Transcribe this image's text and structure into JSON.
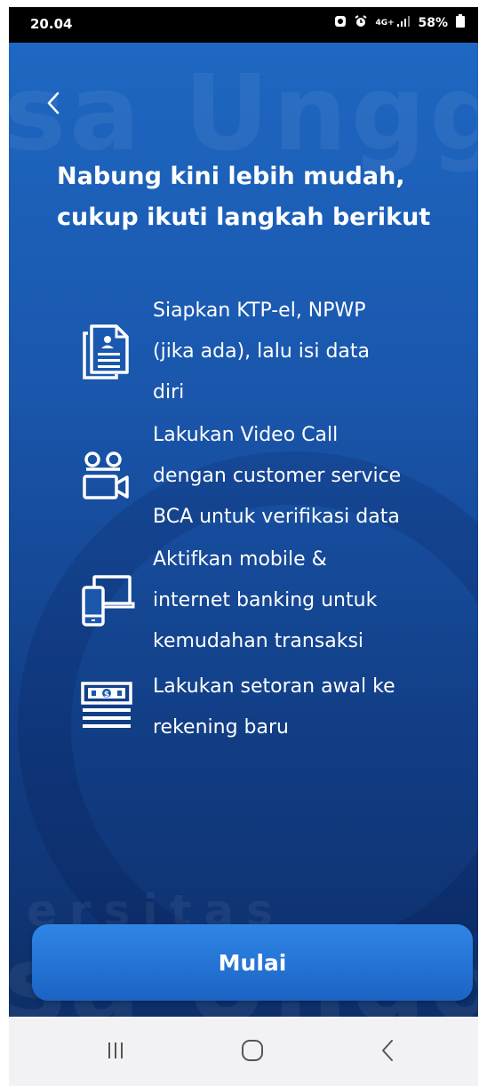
{
  "status_bar": {
    "time": "20.04",
    "battery": "58%",
    "network": "4G+",
    "icons": [
      "gallery-icon",
      "alarm-icon",
      "network-icon",
      "signal-icon",
      "battery-icon"
    ]
  },
  "header": {
    "back_icon": "chevron-left-icon"
  },
  "title": {
    "line1": "Nabung kini lebih mudah,",
    "line2": "cukup ikuti langkah berikut"
  },
  "steps": [
    {
      "icon": "documents-icon",
      "lines": [
        "Siapkan KTP-el, NPWP",
        "(jika ada), lalu isi data",
        "diri"
      ]
    },
    {
      "icon": "video-call-icon",
      "lines": [
        "Lakukan Video Call",
        "dengan customer service",
        "BCA untuk verifikasi data"
      ]
    },
    {
      "icon": "devices-icon",
      "lines": [
        "Aktifkan mobile &",
        "internet banking untuk",
        "kemudahan transaksi"
      ]
    },
    {
      "icon": "money-deposit-icon",
      "lines": [
        "Lakukan setoran awal ke",
        "rekening baru"
      ]
    }
  ],
  "action": {
    "start_label": "Mulai"
  },
  "nav_bar": {
    "recent_icon": "recent-apps-icon",
    "home_icon": "home-icon",
    "back_icon": "back-icon"
  },
  "colors": {
    "background_top": "#1e67c2",
    "background_bottom": "#0d2f6a",
    "button": "#2f86e6",
    "text": "#ffffff",
    "nav_bar": "#f2f2f4"
  }
}
